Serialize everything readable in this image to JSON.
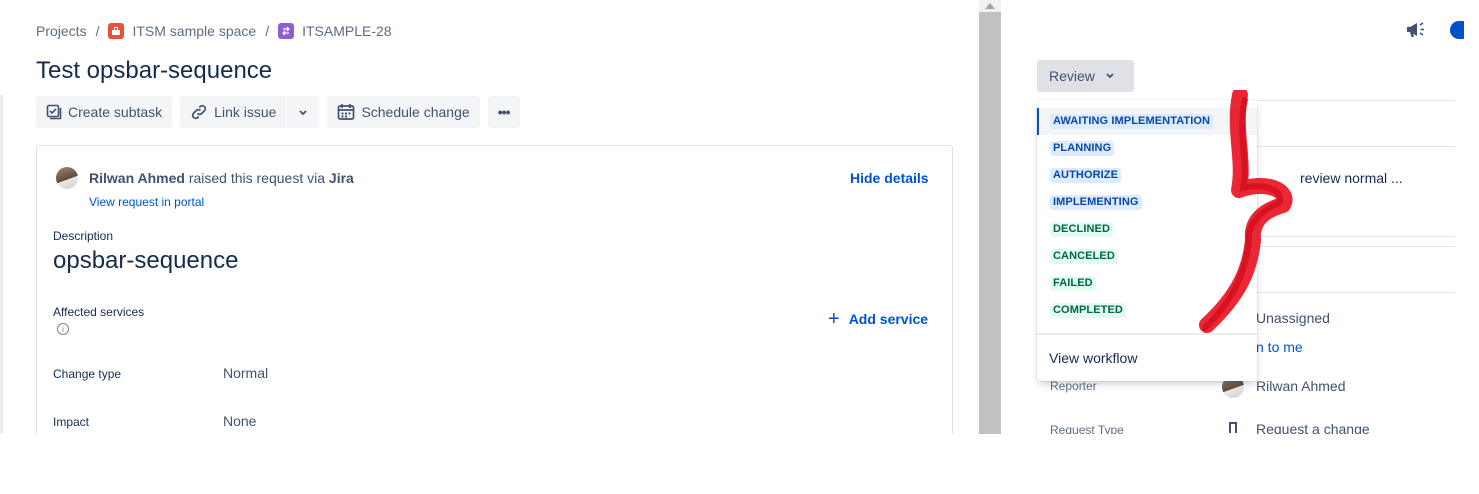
{
  "breadcrumb": {
    "projects": "Projects",
    "separator": "/",
    "space": "ITSM sample space",
    "issue_key": "ITSAMPLE-28"
  },
  "issue": {
    "title": "Test opsbar-sequence"
  },
  "toolbar": {
    "create_subtask": "Create subtask",
    "link_issue": "Link issue",
    "schedule_change": "Schedule change",
    "more": "•••"
  },
  "request": {
    "reporter_name": "Rilwan Ahmed",
    "raised_text": "raised this request via",
    "channel": "Jira",
    "view_portal": "View request in portal",
    "hide_details": "Hide details"
  },
  "fields": {
    "description_label": "Description",
    "description_value": "opsbar-sequence",
    "affected_services_label": "Affected services",
    "add_service": "Add service",
    "change_type_label": "Change type",
    "change_type_value": "Normal",
    "impact_label": "Impact",
    "impact_value": "None"
  },
  "status": {
    "current": "Review",
    "options": [
      {
        "label": "AWAITING IMPLEMENTATION",
        "color": "#deebff"
      },
      {
        "label": "PLANNING",
        "color": "#deebff"
      },
      {
        "label": "AUTHORIZE",
        "color": "#deebff"
      },
      {
        "label": "IMPLEMENTING",
        "color": "#deebff"
      },
      {
        "label": "DECLINED",
        "color": "#e3fcef"
      },
      {
        "label": "CANCELED",
        "color": "#e3fcef"
      },
      {
        "label": "FAILED",
        "color": "#e3fcef"
      },
      {
        "label": "COMPLETED",
        "color": "#e3fcef"
      }
    ],
    "view_workflow": "View workflow"
  },
  "sidebar": {
    "request_type_partial": "review normal ...",
    "assignee_value": "Unassigned",
    "assign_to_me_partial": "n to me",
    "reporter_label": "Reporter",
    "reporter_value": "Rilwan Ahmed",
    "request_type_label": "Request Type",
    "request_type_value": "Request a change"
  },
  "colors": {
    "link": "#0052cc",
    "annotation": "#e8101f"
  },
  "icons": {
    "announcement": "megaphone-icon",
    "space": "toolbox-icon",
    "issue": "change-icon"
  }
}
